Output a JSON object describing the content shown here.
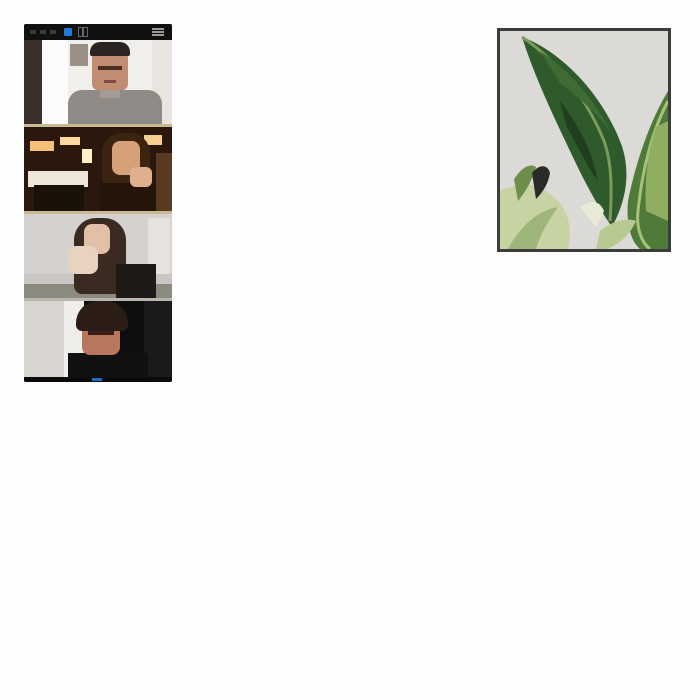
{
  "page": {
    "background": "#fdfdfd"
  },
  "video_call": {
    "topbar": {
      "icons": [
        "signal-icon",
        "camera-icon",
        "grid-view-icon",
        "menu-icon"
      ],
      "accent": "#1e7bd8"
    },
    "participants": [
      {
        "position": 1,
        "appearance": "man-gray-shirt"
      },
      {
        "position": 2,
        "appearance": "woman-warm-lit-room"
      },
      {
        "position": 3,
        "appearance": "woman-leaning-gray-wall"
      },
      {
        "position": 4,
        "appearance": "man-dark-hair"
      }
    ],
    "divider_color": "#c9b995"
  },
  "photo": {
    "subject": "banana-leaf-plant",
    "frame_color": "#3c3c3c",
    "leaf_colors": [
      "#2f5a2c",
      "#4f7a3a",
      "#8fae62",
      "#c8d3a4"
    ]
  }
}
